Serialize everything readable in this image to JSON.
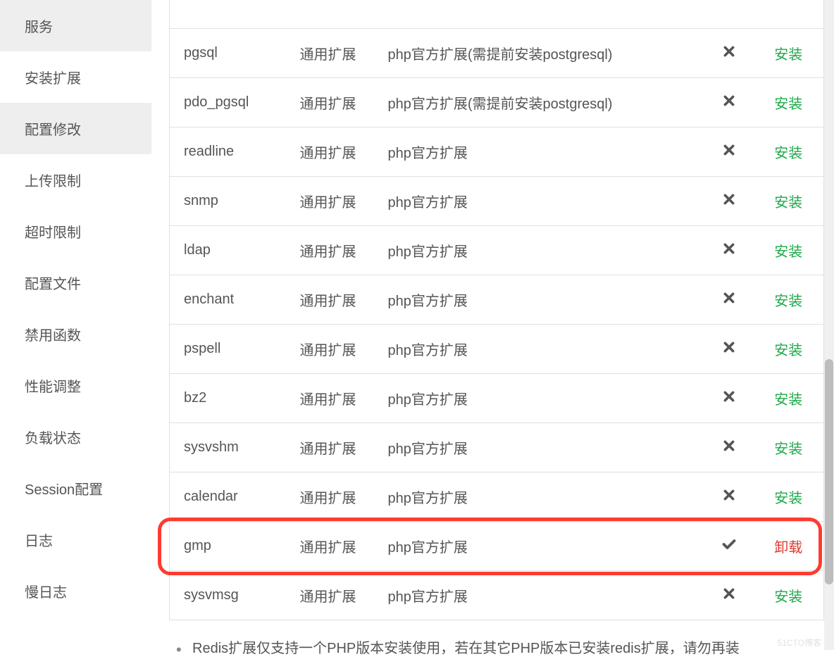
{
  "sidebar": {
    "items": [
      {
        "label": "服务",
        "key": "service",
        "active": true
      },
      {
        "label": "安装扩展",
        "key": "install-extension",
        "active": false
      },
      {
        "label": "配置修改",
        "key": "config-edit",
        "active": true
      },
      {
        "label": "上传限制",
        "key": "upload-limit",
        "active": false
      },
      {
        "label": "超时限制",
        "key": "timeout-limit",
        "active": false
      },
      {
        "label": "配置文件",
        "key": "config-file",
        "active": false
      },
      {
        "label": "禁用函数",
        "key": "disabled-functions",
        "active": false
      },
      {
        "label": "性能调整",
        "key": "performance",
        "active": false
      },
      {
        "label": "负载状态",
        "key": "load-status",
        "active": false
      },
      {
        "label": "Session配置",
        "key": "session-config",
        "active": false
      },
      {
        "label": "日志",
        "key": "logs",
        "active": false
      },
      {
        "label": "慢日志",
        "key": "slow-logs",
        "active": false
      }
    ]
  },
  "actions": {
    "install": "安装",
    "uninstall": "卸载"
  },
  "extensions": [
    {
      "name": "pgsql",
      "type": "通用扩展",
      "desc": "php官方扩展(需提前安装postgresql)",
      "installed": false
    },
    {
      "name": "pdo_pgsql",
      "type": "通用扩展",
      "desc": "php官方扩展(需提前安装postgresql)",
      "installed": false
    },
    {
      "name": "readline",
      "type": "通用扩展",
      "desc": "php官方扩展",
      "installed": false
    },
    {
      "name": "snmp",
      "type": "通用扩展",
      "desc": "php官方扩展",
      "installed": false
    },
    {
      "name": "ldap",
      "type": "通用扩展",
      "desc": "php官方扩展",
      "installed": false
    },
    {
      "name": "enchant",
      "type": "通用扩展",
      "desc": "php官方扩展",
      "installed": false
    },
    {
      "name": "pspell",
      "type": "通用扩展",
      "desc": "php官方扩展",
      "installed": false
    },
    {
      "name": "bz2",
      "type": "通用扩展",
      "desc": "php官方扩展",
      "installed": false
    },
    {
      "name": "sysvshm",
      "type": "通用扩展",
      "desc": "php官方扩展",
      "installed": false
    },
    {
      "name": "calendar",
      "type": "通用扩展",
      "desc": "php官方扩展",
      "installed": false
    },
    {
      "name": "gmp",
      "type": "通用扩展",
      "desc": "php官方扩展",
      "installed": true,
      "highlighted": true
    },
    {
      "name": "sysvmsg",
      "type": "通用扩展",
      "desc": "php官方扩展",
      "installed": false
    }
  ],
  "notes": [
    "Redis扩展仅支持一个PHP版本安装使用，若在其它PHP版本已安装redis扩展，请勿再装"
  ],
  "watermark": "51CTO博客"
}
